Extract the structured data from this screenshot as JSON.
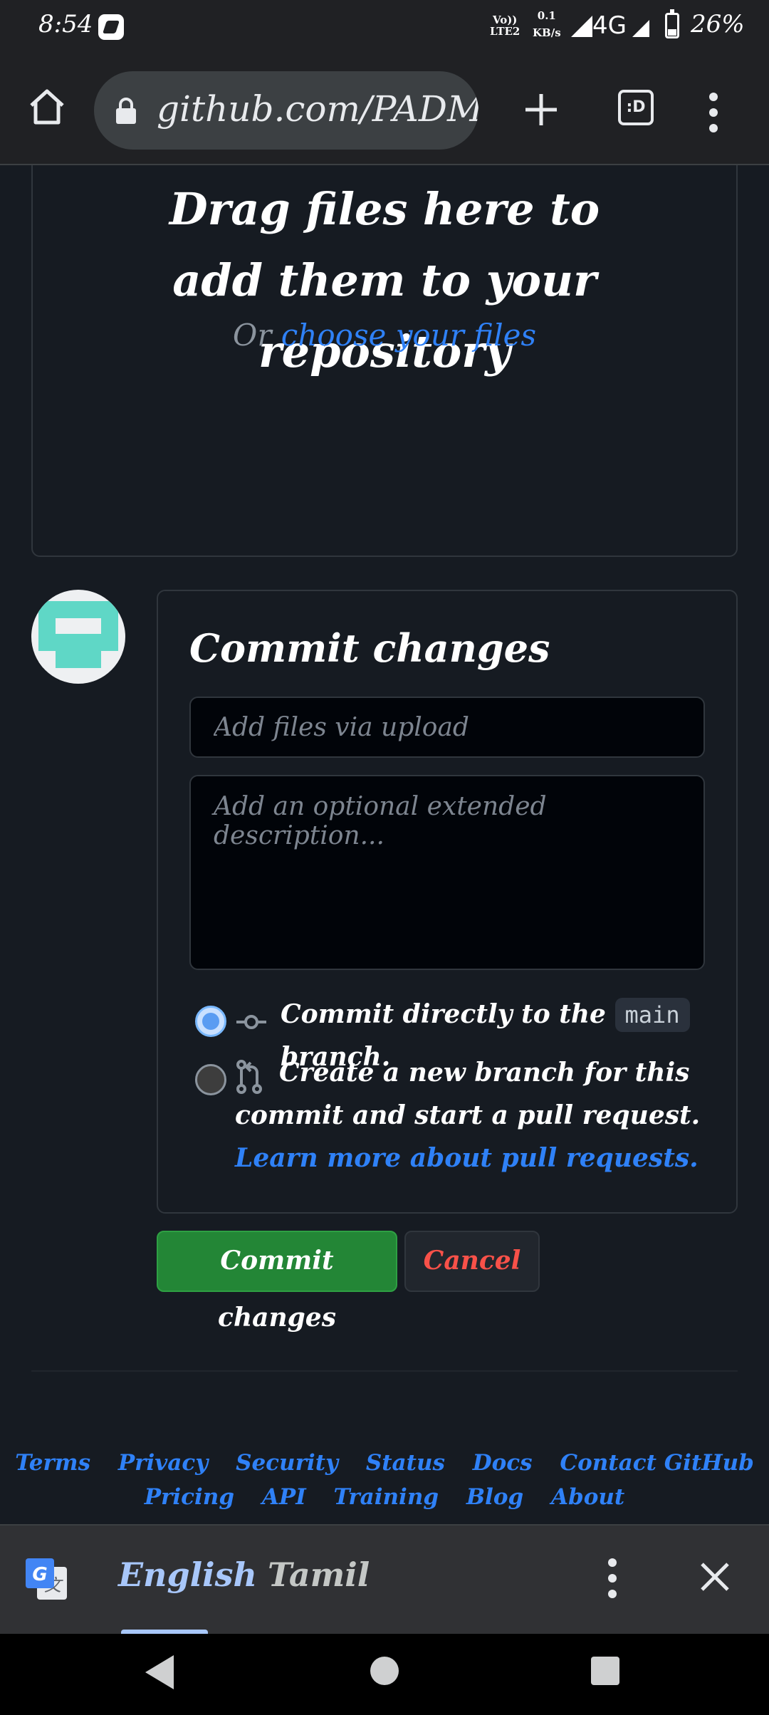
{
  "status_bar": {
    "time": "8:54",
    "volte": "Vo))\nLTE2",
    "speed": "0.1\nKB/s",
    "network": "4G",
    "battery": "26%"
  },
  "browser": {
    "url": "github.com/PADMAP",
    "tabs_label": ":D"
  },
  "dropzone": {
    "title": "Drag files here to add them to your repository",
    "or_text": "Or",
    "choose_link": "choose your files"
  },
  "commit": {
    "title": "Commit changes",
    "summary_placeholder": "Add files via upload",
    "description_placeholder": "Add an optional extended description...",
    "option_direct_prefix": "Commit directly to the",
    "branch_name": "main",
    "option_direct_suffix": "branch.",
    "option_new_branch_text": "Create a new branch for this commit and start a pull request.",
    "learn_more_link": "Learn more about pull requests.",
    "commit_button": "Commit changes",
    "cancel_button": "Cancel"
  },
  "footer": {
    "row1": [
      "Terms",
      "Privacy",
      "Security",
      "Status",
      "Docs",
      "Contact GitHub"
    ],
    "row2": [
      "Pricing",
      "API",
      "Training",
      "Blog",
      "About"
    ]
  },
  "translate_bar": {
    "source_language": "English",
    "target_language": "Tamil"
  },
  "colors": {
    "accent_link": "#2f81f7",
    "commit_green": "#238636",
    "cancel_red": "#f85149",
    "avatar_teal": "#5fd7c6"
  }
}
